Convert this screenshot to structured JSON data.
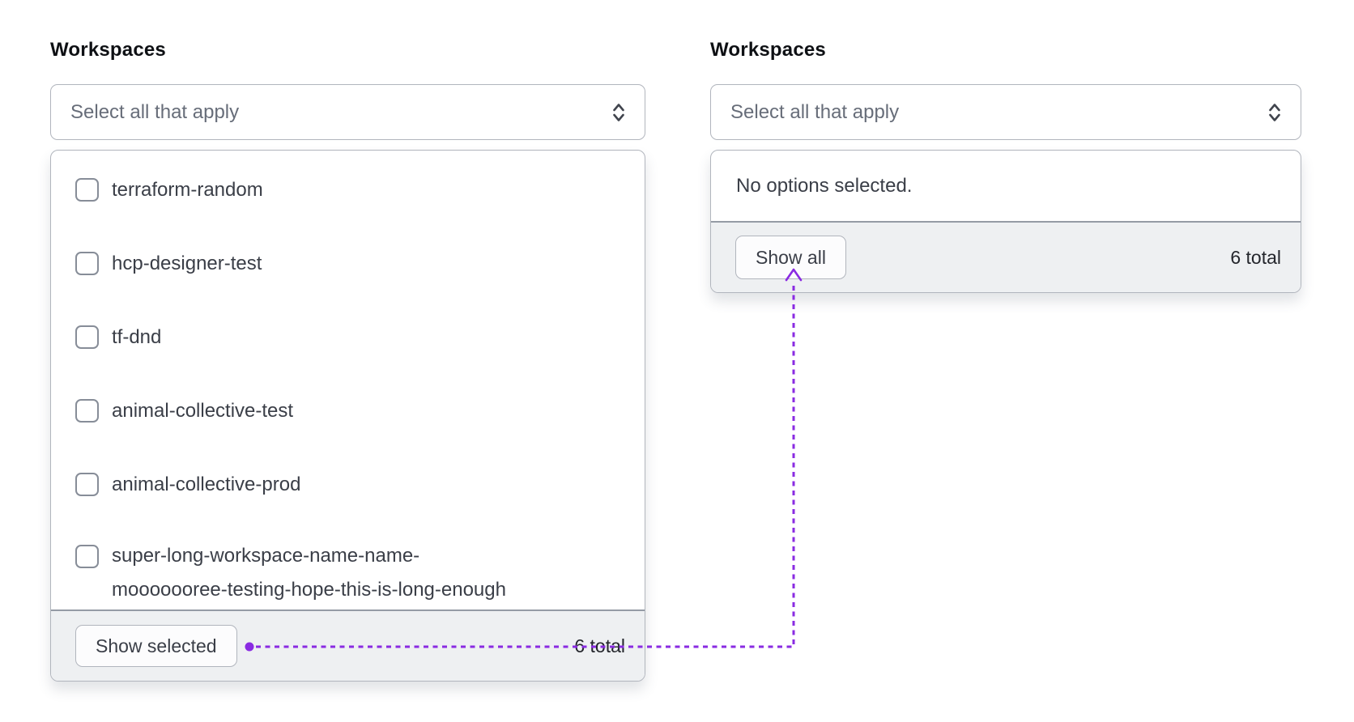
{
  "annotation": {
    "color": "#8a2be2"
  },
  "panels": {
    "left": {
      "label": "Workspaces",
      "trigger_placeholder": "Select all that apply",
      "options": [
        "terraform-random",
        "hcp-designer-test",
        "tf-dnd",
        "animal-collective-test",
        "animal-collective-prod",
        "super-long-workspace-name-name-\nmooooooree-testing-hope-this-is-long-enough"
      ],
      "footer": {
        "button_label": "Show selected",
        "total_label": "6 total"
      }
    },
    "right": {
      "label": "Workspaces",
      "trigger_placeholder": "Select all that apply",
      "empty_message": "No options selected.",
      "footer": {
        "button_label": "Show all",
        "total_label": "6 total"
      }
    }
  }
}
